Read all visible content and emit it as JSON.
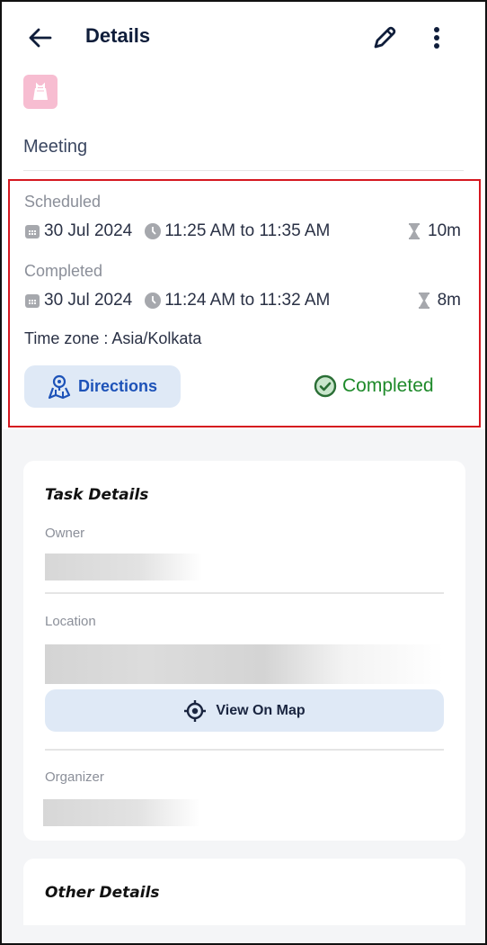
{
  "header": {
    "title": "Details",
    "back_icon": "arrow-left-icon",
    "edit_icon": "pencil-icon",
    "more_icon": "more-vertical-icon"
  },
  "activity": {
    "type_icon": "meeting-bag-icon",
    "type_icon_color": "#f7bdd1",
    "type_label": "Meeting"
  },
  "schedule": {
    "scheduled": {
      "label": "Scheduled",
      "date": "30 Jul 2024",
      "time_range": "11:25 AM to 11:35 AM",
      "duration": "10m"
    },
    "completed": {
      "label": "Completed",
      "date": "30 Jul 2024",
      "time_range": "11:24 AM to 11:32 AM",
      "duration": "8m"
    },
    "timezone": "Time zone : Asia/Kolkata",
    "directions_button": "Directions",
    "status": {
      "label": "Completed",
      "color": "#1e8a2a"
    }
  },
  "task_details": {
    "title": "Task Details",
    "fields": [
      {
        "label": "Owner"
      },
      {
        "label": "Location"
      },
      {
        "label": "Organizer"
      }
    ],
    "view_on_map_button": "View On Map"
  },
  "other_details": {
    "title": "Other Details"
  },
  "colors": {
    "accent": "#1d52b8",
    "button_bg": "#dfe9f6",
    "highlight_border": "#d5181f",
    "page_bg": "#f4f5f7"
  }
}
